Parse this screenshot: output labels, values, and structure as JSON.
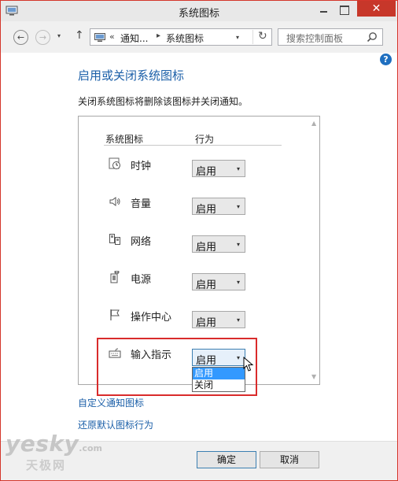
{
  "window": {
    "title": "系统图标",
    "close_glyph": "✕"
  },
  "nav": {
    "back_glyph": "←",
    "forward_glyph": "→",
    "history_glyph": "▾",
    "up_glyph": "↑",
    "address": {
      "prefix": "«",
      "crumb1": "通知...",
      "separator": "▸",
      "crumb2": "系统图标",
      "dropdown_glyph": "▾",
      "refresh_glyph": "↻"
    },
    "search_placeholder": "搜索控制面板"
  },
  "content": {
    "help_glyph": "?",
    "title": "启用或关闭系统图标",
    "description": "关闭系统图标将删除该图标并关闭通知。",
    "columns": {
      "icon": "系统图标",
      "behavior": "行为"
    },
    "scroll_up_glyph": "▲",
    "scroll_down_glyph": "▼",
    "rows": [
      {
        "label": "时钟",
        "icon": "clock-icon",
        "value": "启用"
      },
      {
        "label": "音量",
        "icon": "speaker-icon",
        "value": "启用"
      },
      {
        "label": "网络",
        "icon": "network-icon",
        "value": "启用"
      },
      {
        "label": "电源",
        "icon": "power-icon",
        "value": "启用"
      },
      {
        "label": "操作中心",
        "icon": "flag-icon",
        "value": "启用"
      },
      {
        "label": "输入指示",
        "icon": "keyboard-icon",
        "value": "启用"
      }
    ],
    "select_arrow_glyph": "▾",
    "dropdown_options": [
      "启用",
      "关闭"
    ],
    "links": {
      "customize": "自定义通知图标",
      "restore": "还原默认图标行为"
    }
  },
  "footer": {
    "ok": "确定",
    "cancel": "取消"
  },
  "watermark": {
    "brand": "yesky",
    "domain": ".com",
    "sub": "天极网"
  },
  "colors": {
    "accent": "#1b5fa8",
    "close_red": "#c7372a",
    "highlight_red": "#d92b2b",
    "selection_blue": "#3399ff"
  }
}
